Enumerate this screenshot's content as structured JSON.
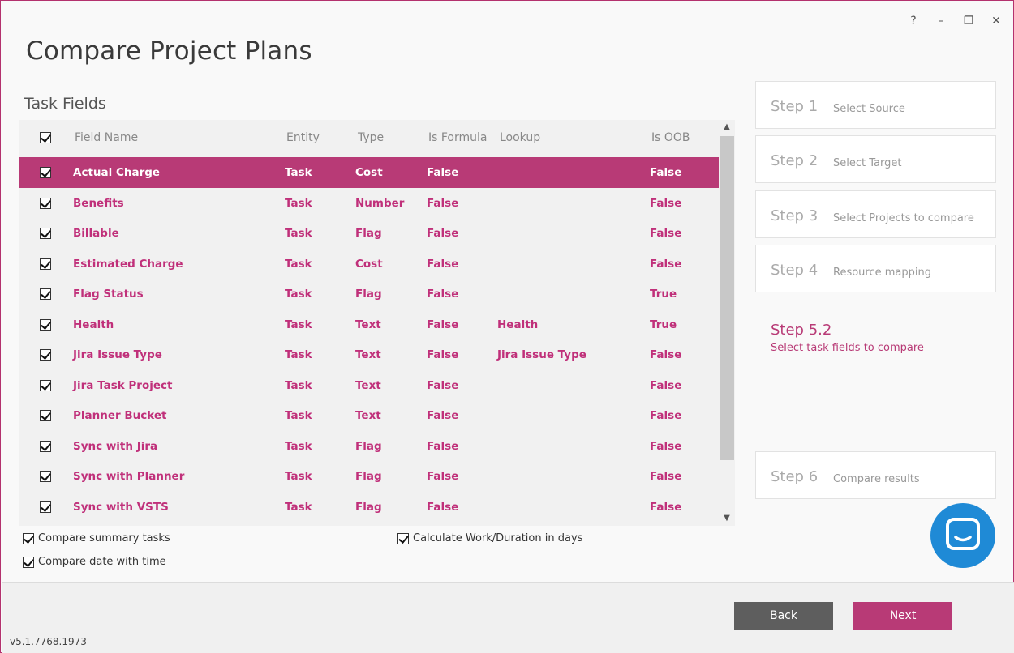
{
  "window": {
    "title": "Compare Project Plans",
    "controls": {
      "help": "?",
      "minimize": "–",
      "restore": "❐",
      "close": "✕"
    }
  },
  "section_title": "Task Fields",
  "grid": {
    "columns": {
      "name": "Field Name",
      "entity": "Entity",
      "type": "Type",
      "formula": "Is Formula",
      "lookup": "Lookup",
      "oob": "Is OOB"
    },
    "rows": [
      {
        "name": "Actual Charge",
        "entity": "Task",
        "type": "Cost",
        "formula": "False",
        "lookup": "",
        "oob": "False",
        "selected": true
      },
      {
        "name": "Benefits",
        "entity": "Task",
        "type": "Number",
        "formula": "False",
        "lookup": "",
        "oob": "False"
      },
      {
        "name": "Billable",
        "entity": "Task",
        "type": "Flag",
        "formula": "False",
        "lookup": "",
        "oob": "False"
      },
      {
        "name": "Estimated Charge",
        "entity": "Task",
        "type": "Cost",
        "formula": "False",
        "lookup": "",
        "oob": "False"
      },
      {
        "name": "Flag Status",
        "entity": "Task",
        "type": "Flag",
        "formula": "False",
        "lookup": "",
        "oob": "True"
      },
      {
        "name": "Health",
        "entity": "Task",
        "type": "Text",
        "formula": "False",
        "lookup": "Health",
        "oob": "True"
      },
      {
        "name": "Jira Issue Type",
        "entity": "Task",
        "type": "Text",
        "formula": "False",
        "lookup": "Jira Issue Type",
        "oob": "False"
      },
      {
        "name": "Jira Task Project",
        "entity": "Task",
        "type": "Text",
        "formula": "False",
        "lookup": "",
        "oob": "False"
      },
      {
        "name": "Planner Bucket",
        "entity": "Task",
        "type": "Text",
        "formula": "False",
        "lookup": "",
        "oob": "False"
      },
      {
        "name": "Sync with Jira",
        "entity": "Task",
        "type": "Flag",
        "formula": "False",
        "lookup": "",
        "oob": "False"
      },
      {
        "name": "Sync with Planner",
        "entity": "Task",
        "type": "Flag",
        "formula": "False",
        "lookup": "",
        "oob": "False"
      },
      {
        "name": "Sync with VSTS",
        "entity": "Task",
        "type": "Flag",
        "formula": "False",
        "lookup": "",
        "oob": "False"
      }
    ]
  },
  "options": {
    "compare_summary": "Compare summary tasks",
    "compare_date_time": "Compare date with time",
    "calc_work_days": "Calculate Work/Duration in days"
  },
  "steps": [
    {
      "num": "Step 1",
      "desc": "Select Source"
    },
    {
      "num": "Step 2",
      "desc": "Select Target"
    },
    {
      "num": "Step 3",
      "desc": "Select Projects to compare"
    },
    {
      "num": "Step 4",
      "desc": "Resource mapping"
    },
    {
      "num": "Step 5.2",
      "desc": "Select task fields to compare"
    },
    {
      "num": "Step 6",
      "desc": "Compare results"
    }
  ],
  "buttons": {
    "back": "Back",
    "next": "Next"
  },
  "version": "v5.1.7768.1973",
  "colors": {
    "accent": "#b83a76",
    "chat": "#1f8ad6",
    "back_button": "#5e5e5e"
  }
}
